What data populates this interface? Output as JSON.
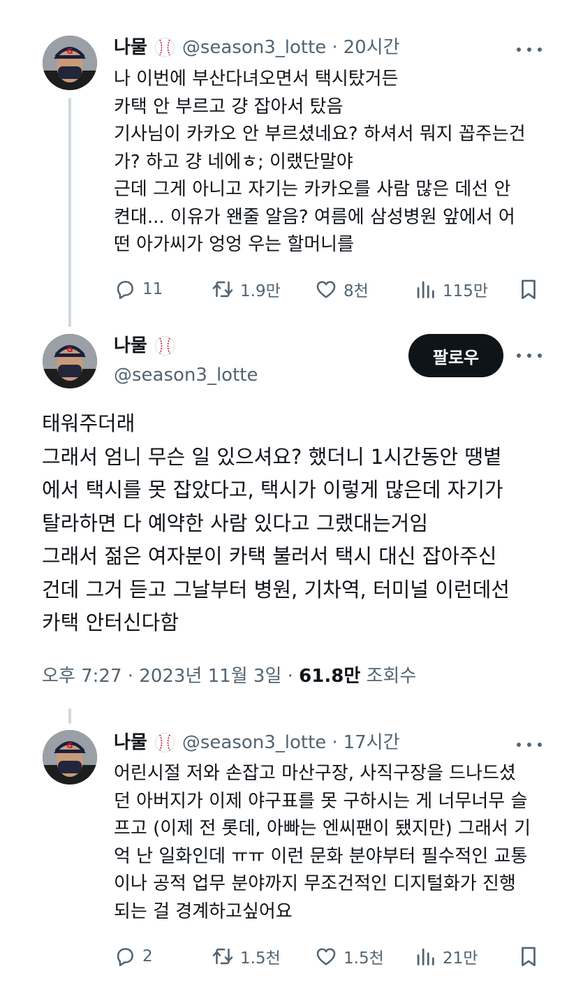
{
  "tweet1": {
    "name": "나물",
    "handle": "@season3_lotte",
    "time": "20시간",
    "lines": [
      "나 이번에 부산다녀오면서 택시탔거든",
      "카택 안 부르고 걍 잡아서 탔음",
      "기사님이 카카오 안 부르셨네요? 하셔서 뭐지 꼽주는건",
      "가? 하고 걍 네에ㅎ; 이랬단말야",
      "근데 그게 아니고 자기는 카카오를 사람 많은 데선 안",
      "켠대... 이유가 왠줄 알음? 여름에 삼성병원 앞에서 어",
      "떤 아가씨가 엉엉 우는 할머니를"
    ],
    "replies": "11",
    "retweets": "1.9만",
    "likes": "8천",
    "views": "115만"
  },
  "main": {
    "name": "나물",
    "handle": "@season3_lotte",
    "follow_label": "팔로우",
    "lines": [
      "태워주더래",
      "그래서 엄니 무슨 일 있으셔요? 했더니 1시간동안 땡볕",
      "에서 택시를 못 잡았다고, 택시가 이렇게 많은데 자기가",
      "탈라하면 다 예약한 사람 있다고 그랬대는거임",
      "그래서 젊은 여자분이 카택 불러서 택시 대신 잡아주신",
      "건데 그거 듣고 그날부터 병원, 기차역, 터미널 이런데선",
      "카택 안터신다함"
    ],
    "meta_time": "오후 7:27 · 2023년 11월 3일 · ",
    "meta_views": "61.8만",
    "meta_views_label": " 조회수"
  },
  "tweet2": {
    "name": "나물",
    "handle": "@season3_lotte",
    "time": "17시간",
    "lines": [
      "어린시절 저와 손잡고 마산구장, 사직구장을 드나드셨",
      "던 아버지가 이제 야구표를 못 구하시는 게 너무너무 슬",
      "프고 (이제 전 롯데, 아빠는 엔씨팬이 됐지만) 그래서 기",
      "억 난 일화인데 ㅠㅠ 이런 문화 분야부터 필수적인 교통",
      "이나 공적 업무 분야까지 무조건적인 디지털화가 진행",
      "되는 걸 경계하고싶어요"
    ],
    "replies": "2",
    "retweets": "1.5천",
    "likes": "1.5천",
    "views": "21만"
  },
  "dot": "·",
  "colors": {
    "text": "#0f1419",
    "muted": "#536471",
    "line": "#cfd9de",
    "badge_red": "#c8102e"
  }
}
